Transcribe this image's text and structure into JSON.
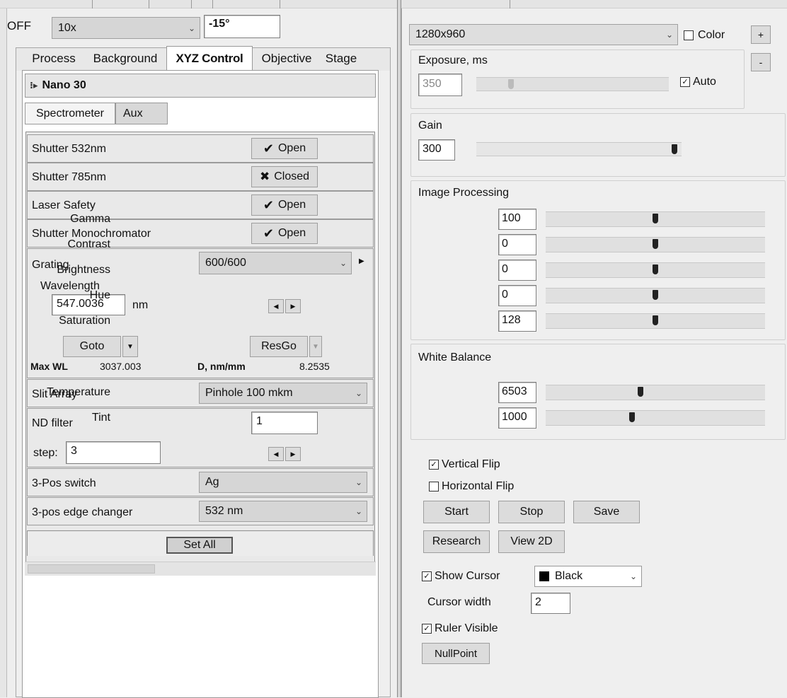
{
  "top": {
    "off_label": "OFF",
    "magnification": "10x",
    "angle": "-15°"
  },
  "left": {
    "tabs": [
      "Process",
      "Background",
      "XYZ Control",
      "Objective",
      "Stage"
    ],
    "active_tab": "XYZ Control",
    "device_header": "Nano 30",
    "subtabs": [
      "Spectrometer",
      "Aux"
    ],
    "shutters": [
      {
        "label": "Shutter 532nm",
        "state": "Open",
        "glyph": "✔"
      },
      {
        "label": "Shutter 785nm",
        "state": "Closed",
        "glyph": "✖"
      },
      {
        "label": "Laser Safety",
        "state": "Open",
        "glyph": "✔"
      },
      {
        "label": "Shutter Monochromator",
        "state": "Open",
        "glyph": "✔"
      }
    ],
    "grating": {
      "label": "Grating",
      "value": "600/600"
    },
    "wavelength": {
      "label": "Wavelength",
      "value": "547.0036",
      "unit": "nm",
      "goto_label": "Goto",
      "resgo_label": "ResGo",
      "max_wl_label": "Max WL",
      "max_wl_value": "3037.003",
      "disp_label": "D, nm/mm",
      "disp_value": "8.2535"
    },
    "slit": {
      "label": "Slit Array",
      "value": "Pinhole 100 mkm"
    },
    "nd": {
      "label": "ND filter",
      "value": "1",
      "step_label": "step:",
      "step_value": "3"
    },
    "switch3": {
      "label": "3-Pos switch",
      "value": "Ag"
    },
    "edge": {
      "label": "3-pos edge changer",
      "value": "532 nm"
    },
    "set_all_label": "Set All"
  },
  "right": {
    "resolution": "1280x960",
    "color_label": "Color",
    "color_checked": false,
    "plus_label": "+",
    "minus_label": "-",
    "exposure": {
      "label": "Exposure, ms",
      "value": "350",
      "auto_label": "Auto",
      "auto_checked": true,
      "level": 0.17
    },
    "gain": {
      "label": "Gain",
      "value": "300",
      "level": 0.98
    },
    "image_processing": {
      "title": "Image Processing",
      "rows": [
        {
          "label": "Gamma",
          "value": "100",
          "level": 0.5
        },
        {
          "label": "Contrast",
          "value": "0",
          "level": 0.5
        },
        {
          "label": "Brightness",
          "value": "0",
          "level": 0.5
        },
        {
          "label": "Hue",
          "value": "0",
          "level": 0.5
        },
        {
          "label": "Saturation",
          "value": "128",
          "level": 0.5
        }
      ]
    },
    "white_balance": {
      "title": "White Balance",
      "rows": [
        {
          "label": "Temperature",
          "value": "6503",
          "level": 0.43
        },
        {
          "label": "Tint",
          "value": "1000",
          "level": 0.39
        }
      ]
    },
    "vertical_flip": {
      "label": "Vertical Flip",
      "checked": true
    },
    "horizontal_flip": {
      "label": "Horizontal Flip",
      "checked": false
    },
    "buttons": {
      "start": "Start",
      "stop": "Stop",
      "save": "Save",
      "research": "Research",
      "view2d": "View 2D"
    },
    "show_cursor": {
      "label": "Show Cursor",
      "checked": true,
      "color": "Black"
    },
    "cursor_width": {
      "label": "Cursor width",
      "value": "2"
    },
    "ruler_visible": {
      "label": "Ruler Visible",
      "checked": true
    },
    "nullpoint_label": "NullPoint"
  }
}
